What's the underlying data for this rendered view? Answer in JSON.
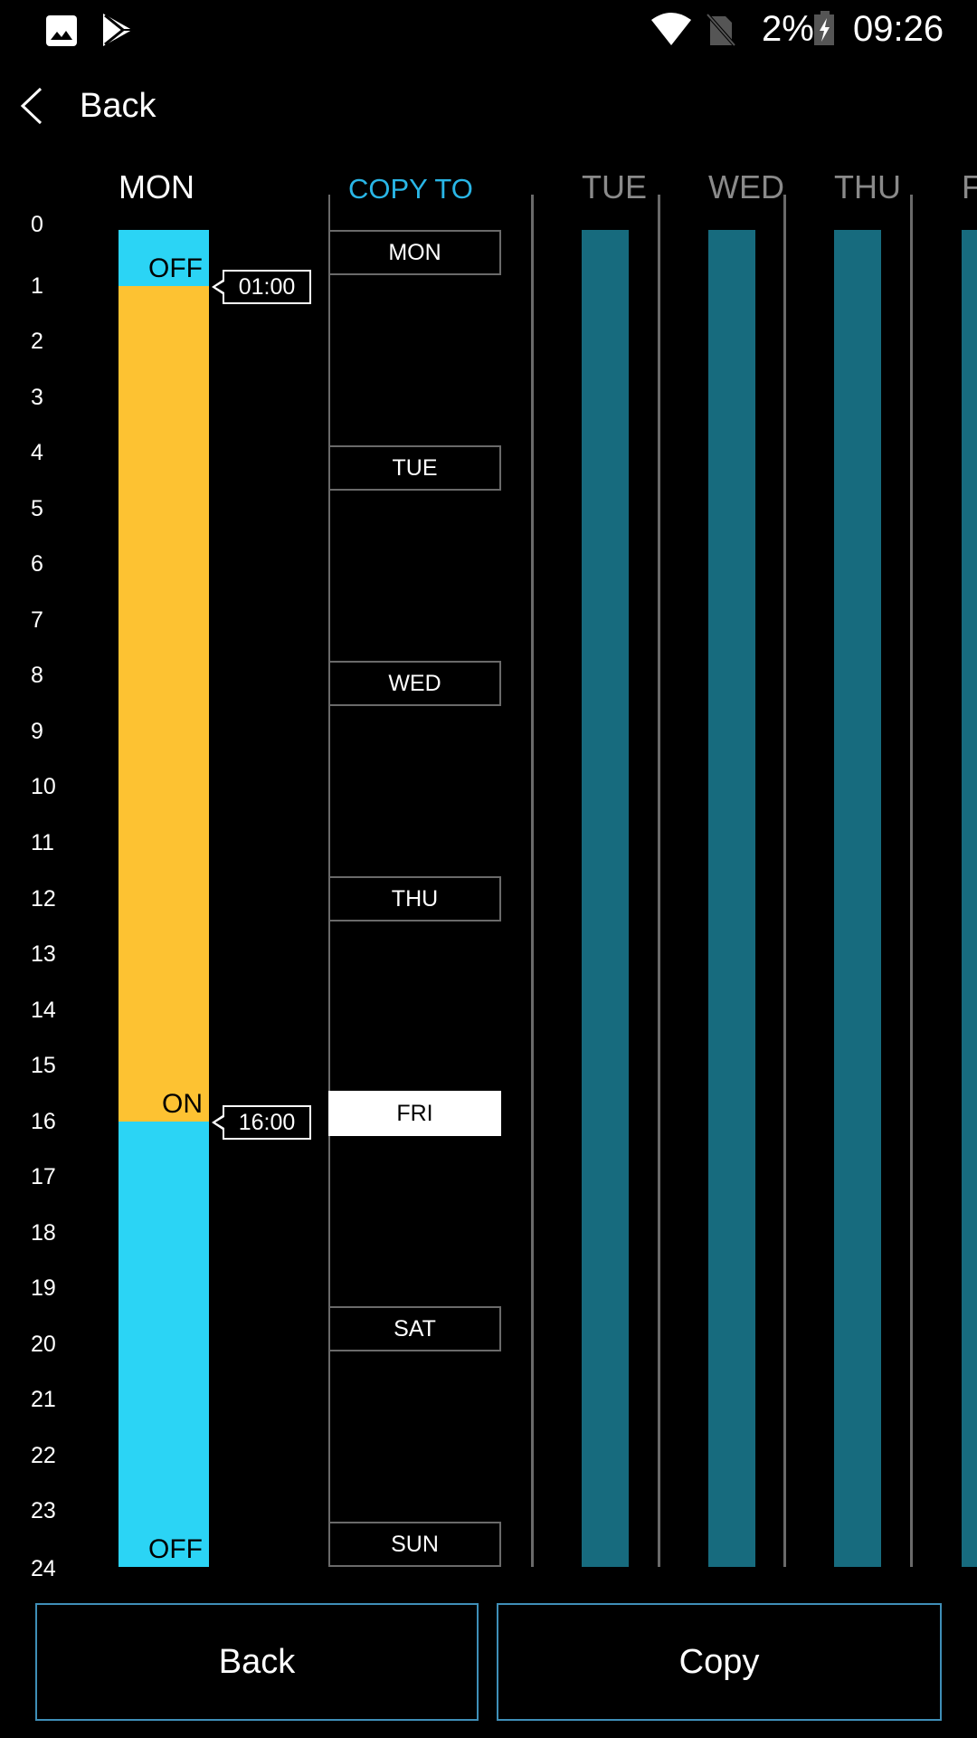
{
  "status_bar": {
    "left_icons": [
      "gallery-icon",
      "play-store-icon"
    ],
    "right_icons": [
      "wifi-icon",
      "no-sim-icon",
      "battery-charging-icon"
    ],
    "battery_percent": "2%",
    "time": "09:26"
  },
  "top_bar": {
    "back_label": "Back"
  },
  "schedule": {
    "current_day": "MON",
    "copy_to_title": "COPY TO",
    "hours": [
      "0",
      "1",
      "2",
      "3",
      "4",
      "5",
      "6",
      "7",
      "8",
      "9",
      "10",
      "11",
      "12",
      "13",
      "14",
      "15",
      "16",
      "17",
      "18",
      "19",
      "20",
      "21",
      "22",
      "23",
      "24"
    ],
    "segments": [
      {
        "state": "OFF",
        "start": 0,
        "end": 1,
        "color": "#2bd4f5"
      },
      {
        "state": "ON",
        "start": 1,
        "end": 16,
        "color": "#fdc232"
      },
      {
        "state": "OFF",
        "start": 16,
        "end": 24,
        "color": "#2bd4f5"
      }
    ],
    "markers": [
      {
        "label": "01:00",
        "hour": 1
      },
      {
        "label": "16:00",
        "hour": 16
      }
    ],
    "copy_to_days": [
      {
        "label": "MON",
        "selected": false
      },
      {
        "label": "TUE",
        "selected": false
      },
      {
        "label": "WED",
        "selected": false
      },
      {
        "label": "THU",
        "selected": false
      },
      {
        "label": "FRI",
        "selected": true
      },
      {
        "label": "SAT",
        "selected": false
      },
      {
        "label": "SUN",
        "selected": false
      }
    ],
    "other_days": [
      {
        "label": "TUE",
        "color": "#176b7e"
      },
      {
        "label": "WED",
        "color": "#176b7e"
      },
      {
        "label": "THU",
        "color": "#176b7e"
      },
      {
        "label": "F",
        "color": "#176b7e"
      }
    ]
  },
  "footer": {
    "back_button": "Back",
    "copy_button": "Copy"
  }
}
